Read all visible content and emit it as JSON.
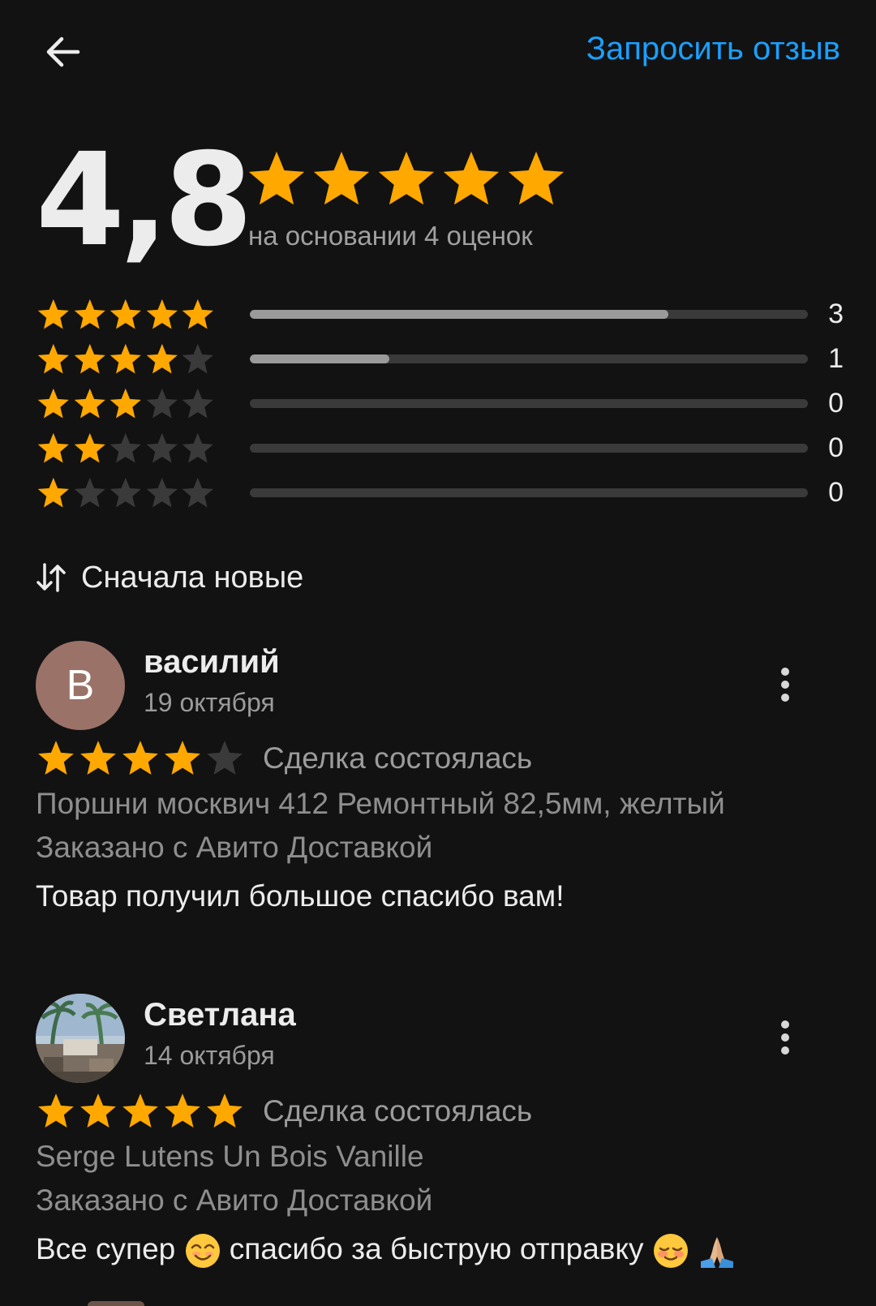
{
  "header": {
    "request_review_label": "Запросить отзыв"
  },
  "summary": {
    "rating": "4,8",
    "rating_value": 4.8,
    "based_on": "на основании 4 оценок"
  },
  "distribution": [
    {
      "stars": 5,
      "count": "3",
      "fraction": 0.75
    },
    {
      "stars": 4,
      "count": "1",
      "fraction": 0.25
    },
    {
      "stars": 3,
      "count": "0",
      "fraction": 0
    },
    {
      "stars": 2,
      "count": "0",
      "fraction": 0
    },
    {
      "stars": 1,
      "count": "0",
      "fraction": 0
    }
  ],
  "sort": {
    "label": "Сначала новые"
  },
  "reviews": [
    {
      "avatar_letter": "В",
      "name": "василий",
      "date": "19 октября",
      "stars": 4,
      "status": "Сделка состоялась",
      "product": "Поршни москвич 412 Ремонтный 82,5мм, желтый",
      "delivery": "Заказано с Авито Доставкой",
      "text": "Товар получил большое спасибо вам!"
    },
    {
      "avatar_letter": "",
      "name": "Светлана",
      "date": "14 октября",
      "stars": 5,
      "status": "Сделка состоялась",
      "product": "Serge Lutens Un Bois Vanille",
      "delivery": "Заказано с Авито Доставкой",
      "text_part1": "Все супер",
      "text_part2": "спасибо за быструю отправку"
    }
  ],
  "colors": {
    "accent": "#1aa0ff",
    "star_filled": "#ffa800",
    "star_empty": "#3a3a3a",
    "background": "#121212"
  },
  "icons": {
    "back": "arrow-left-icon",
    "sort": "sort-arrows-icon",
    "more": "more-vertical-icon",
    "star": "star-icon"
  }
}
